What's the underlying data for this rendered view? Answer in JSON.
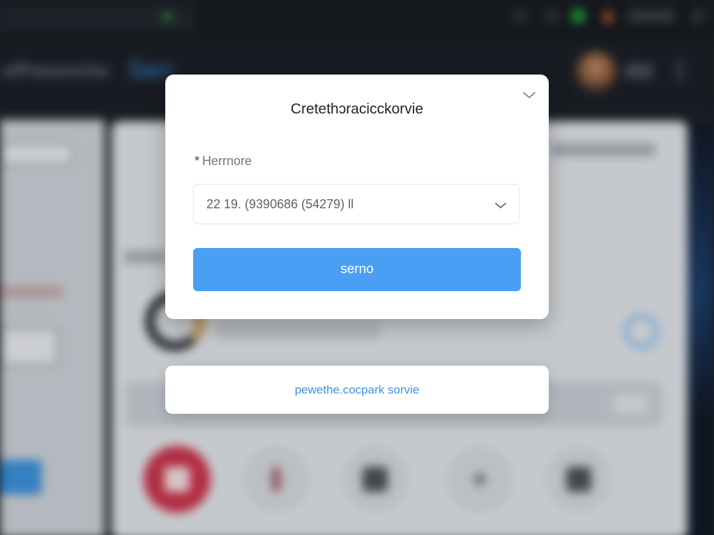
{
  "background": {
    "brand_text": "efPewonche",
    "brand_accent": "Sarr"
  },
  "modal": {
    "title": "Cretethɔracicckorvie",
    "field": {
      "required_marker": "*",
      "label": "Herrnore",
      "selected_value": "22 19. (9390686 (54279) ll"
    },
    "primary_button": "serno"
  },
  "secondary": {
    "link": "pewethe.cocpark sorvie"
  },
  "colors": {
    "primary": "#4a9ff5",
    "link": "#3d92e6",
    "backdrop": "#1b1e25"
  }
}
